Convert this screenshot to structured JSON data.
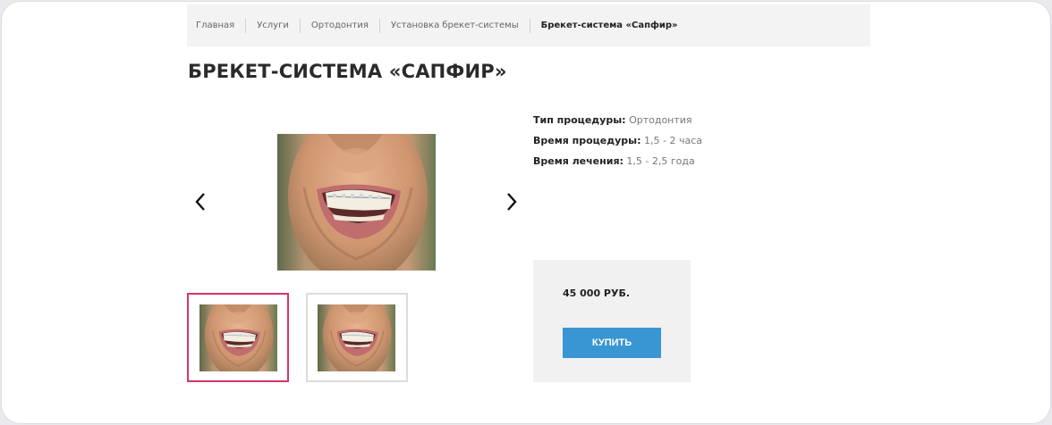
{
  "breadcrumb": [
    {
      "label": "Главная"
    },
    {
      "label": "Услуги"
    },
    {
      "label": "Ортодонтия"
    },
    {
      "label": "Установка брекет-системы"
    },
    {
      "label": "Брекет-система «Сапфир»"
    }
  ],
  "page_title": "БРЕКЕТ-СИСТЕМА «САПФИР»",
  "gallery": {
    "prev_icon": "chevron-left-icon",
    "next_icon": "chevron-right-icon",
    "main_image": "smile-with-braces-photo",
    "thumbnails": [
      {
        "image": "smile-with-braces-photo",
        "active": true
      },
      {
        "image": "smile-with-braces-photo",
        "active": false
      }
    ],
    "active_border_color": "#d6336c"
  },
  "info": {
    "procedure_type_label": "Тип процедуры:",
    "procedure_type_value": "Ортодонтия",
    "procedure_time_label": "Время процедуры:",
    "procedure_time_value": "1,5 - 2 часа",
    "treatment_time_label": "Время лечения:",
    "treatment_time_value": "1,5 - 2,5 года"
  },
  "purchase": {
    "price": "45 000 РУБ.",
    "buy_label": "КУПИТЬ",
    "button_color": "#3a96d3"
  }
}
